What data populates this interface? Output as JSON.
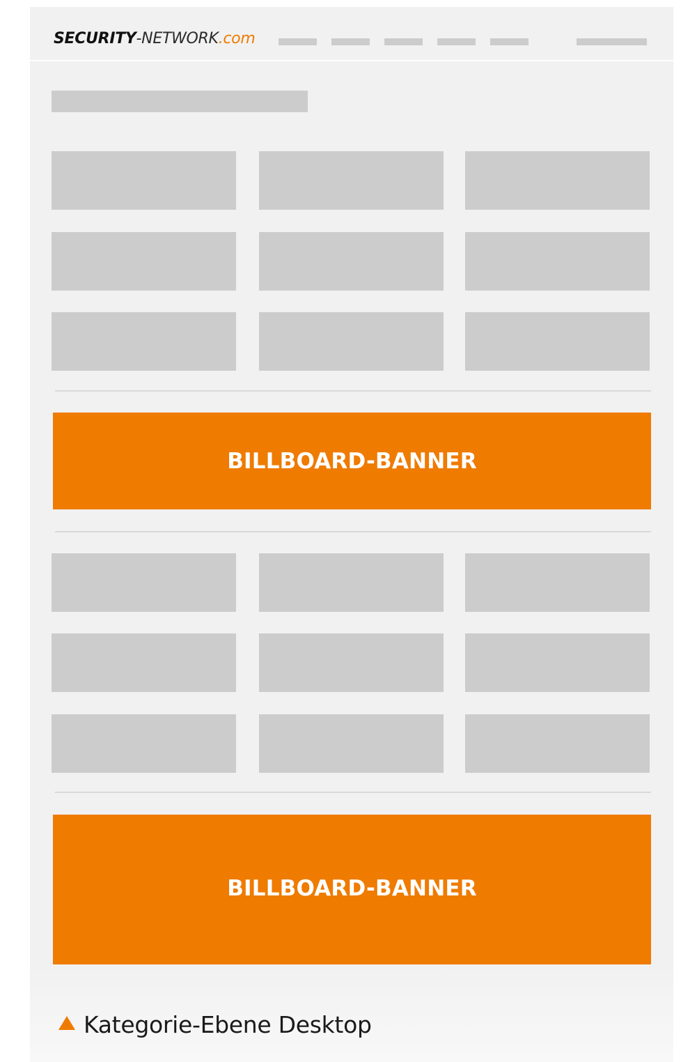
{
  "header": {
    "logo": {
      "brand": "SECURITY",
      "network": "-NETWORK",
      "tld": ".com"
    }
  },
  "banners": [
    {
      "label": "BILLBOARD-BANNER"
    },
    {
      "label": "BILLBOARD-BANNER"
    }
  ],
  "caption": {
    "icon": "triangle-up-icon",
    "text": "Kategorie-Ebene Desktop"
  },
  "colors": {
    "accent": "#ef7b00",
    "placeholder": "#cccccc",
    "page_background": "#f1f1f1"
  }
}
